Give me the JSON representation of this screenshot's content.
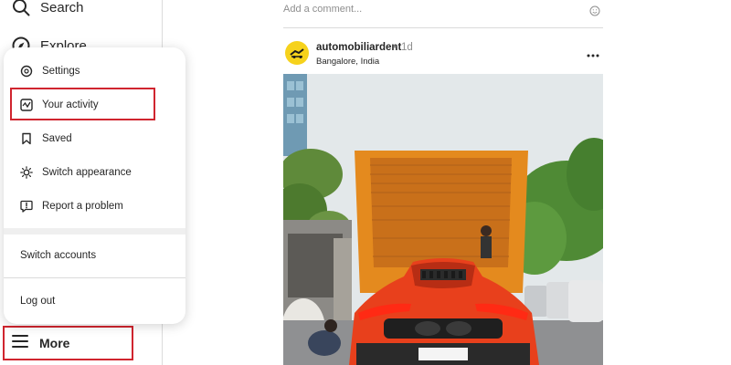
{
  "sidebar": {
    "search_label": "Search",
    "explore_label": "Explore",
    "more_label": "More"
  },
  "menu": {
    "items": [
      {
        "label": "Settings",
        "icon": "settings-icon"
      },
      {
        "label": "Your activity",
        "icon": "activity-icon"
      },
      {
        "label": "Saved",
        "icon": "bookmark-icon"
      },
      {
        "label": "Switch appearance",
        "icon": "sun-icon"
      },
      {
        "label": "Report a problem",
        "icon": "report-icon"
      }
    ],
    "switch_accounts_label": "Switch accounts",
    "logout_label": "Log out"
  },
  "feed": {
    "comment_placeholder": "Add a comment...",
    "post": {
      "username": "automobiliardent",
      "separator": "•",
      "time": "1d",
      "location": "Bangalore, India"
    }
  },
  "colors": {
    "highlight": "#d0252f",
    "border": "#dbdbdb",
    "muted_text": "#8e8e8e",
    "car": "#e8401c",
    "truck": "#e48a1e"
  }
}
